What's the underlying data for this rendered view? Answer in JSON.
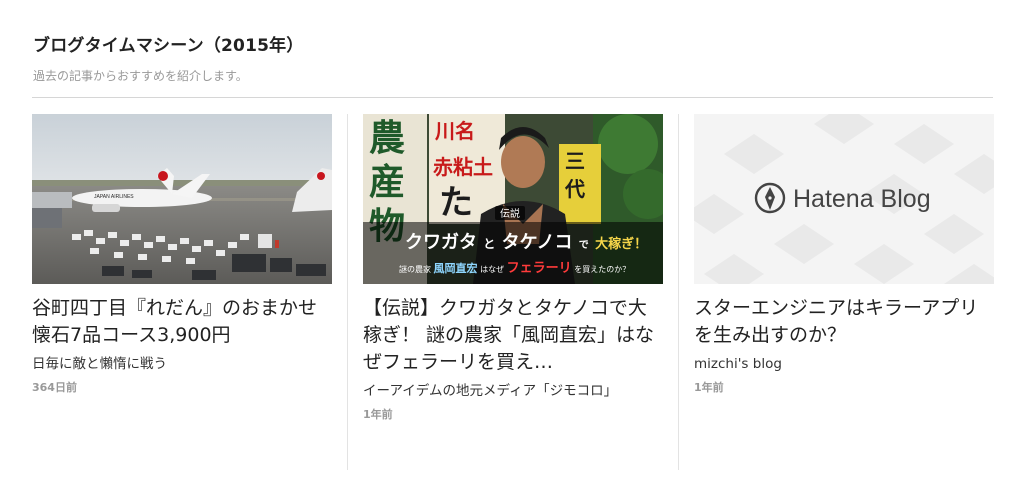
{
  "section": {
    "title": "ブログタイムマシーン（2015年）",
    "subtitle": "過去の記事からおすすめを紹介します。"
  },
  "cards": [
    {
      "title": "谷町四丁目『れだん』のおまかせ懐石7品コース3,900円",
      "blog": "日毎に敵と懶惰に戦う",
      "date": "364日前",
      "thumbnail": {
        "kind": "airport-photo",
        "plane_text": "JAPAN AIRLINES"
      }
    },
    {
      "title": "【伝説】クワガタとタケノコで大稼ぎ！ 謎の農家「風岡直宏」はなぜフェラーリを買え…",
      "blog": "イーアイデムの地元メディア「ジモコロ」",
      "date": "1年前",
      "thumbnail": {
        "kind": "farmer-photo",
        "sign_left": "農産物",
        "sign_center": "元祖 川名 赤粘土",
        "sign_right": "三代",
        "caption_tag": "伝説",
        "caption_line1_a": "クワガタ",
        "caption_line1_b": "と",
        "caption_line1_c": "タケノコ",
        "caption_line1_d": "で",
        "caption_line1_e": "大稼ぎ！",
        "caption_line2_a": "謎の農家",
        "caption_line2_b": "風岡直宏",
        "caption_line2_c": "はなぜ",
        "caption_line2_d": "フェラーリ",
        "caption_line2_e": "を買えたのか？"
      }
    },
    {
      "title": "スターエンジニアはキラーアプリを生み出すのか？",
      "blog": "mizchi's blog",
      "date": "1年前",
      "thumbnail": {
        "kind": "hatena-placeholder",
        "logo_text": "Hatena Blog"
      }
    }
  ]
}
